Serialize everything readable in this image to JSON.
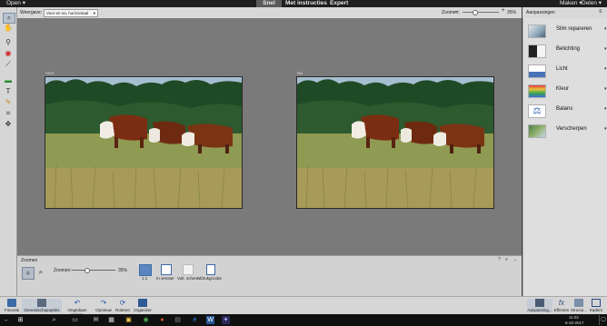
{
  "menubar": {
    "open_label": "Open",
    "modes": [
      "Snel",
      "Met instructies",
      "Expert"
    ],
    "create_label": "Maken",
    "share_label": "Delen"
  },
  "options": {
    "view_label": "Weergave:",
    "view_value": "Voor en na, horizontaal",
    "zoom_label": "Zoomen:",
    "zoom_percent": "35%",
    "zoom_fraction": 0.35
  },
  "canvas": {
    "before_label": "Voor",
    "after_label": "Na"
  },
  "bottom_panel": {
    "title": "Zoomen",
    "zoom_label": "Zoomen:",
    "zoom_percent": "35%",
    "zoom_fraction": 0.35,
    "buttons": [
      "1:1",
      "In venster",
      "Volt. scherm",
      "Afdrukgrootte"
    ]
  },
  "adjustments": {
    "header": "Aanpassingen",
    "items": [
      "Slim repareren",
      "Belichting",
      "Licht",
      "Kleur",
      "Balans",
      "Verscherpen"
    ]
  },
  "app_bar": {
    "left": [
      "Fotovak",
      "Gereedschapopties",
      "Ongedaan maken",
      "Opnieuw",
      "Roteren",
      "Organizer"
    ],
    "right": [
      "Aanpassing...",
      "Effecten",
      "Structu...",
      "Kaders"
    ]
  },
  "taskbar": {
    "time": "11:02",
    "date": "6-10-2017"
  }
}
